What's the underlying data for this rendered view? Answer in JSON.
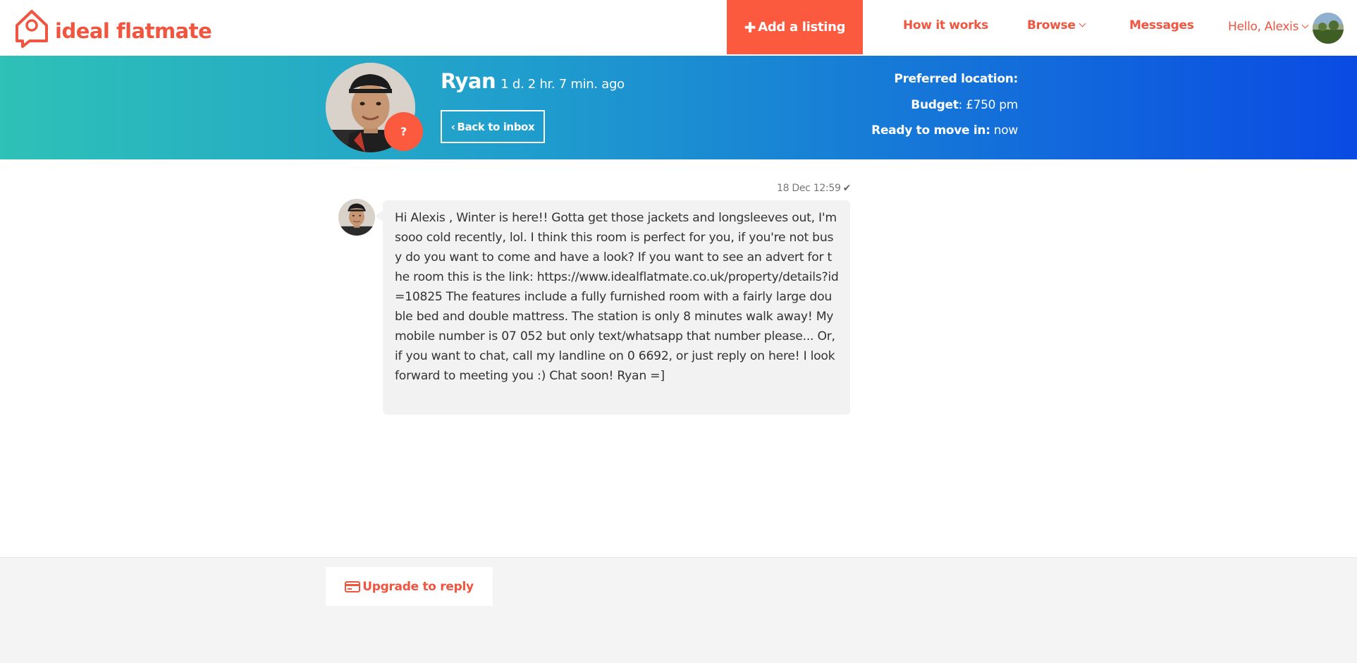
{
  "nav": {
    "logo_text": "ideal flatmate",
    "add_listing_label": "Add a listing",
    "how_it_works_label": "How it works",
    "browse_label": "Browse",
    "messages_label": "Messages",
    "hello_label": "Hello, Alexis"
  },
  "conversation": {
    "contact_name": "Ryan",
    "last_seen": "1 d. 2 hr. 7 min. ago",
    "back_label": "Back to inbox",
    "verification_badge": "?",
    "preferred_location_label": "Preferred location:",
    "budget_label": "Budget",
    "budget_value": ": £750 pm",
    "move_in_label": "Ready to move in:",
    "move_in_value": " now"
  },
  "messages": [
    {
      "timestamp": "18 Dec 12:59",
      "status_icon": "check-icon",
      "text": "Hi Alexis , Winter is here!! Gotta get those jackets and longsleeves out, I'm sooo cold recently, lol. I think this room is perfect for you, if you're not busy do you want to come and have a look? If you want to see an advert for the room this is the link: https://www.idealflatmate.co.uk/property/details?id=10825 The features include a fully furnished room with a fairly large double bed and double mattress. The station is only 8 minutes walk away! My mobile number is 07 052 but only text/whatsapp that number please... Or, if you want to chat, call my landline on 0 6692, or just reply on here! I look forward to meeting you :) Chat soon! Ryan =]"
    }
  ],
  "footer": {
    "upgrade_label": "Upgrade to reply"
  },
  "colors": {
    "brand": "#fb5a3f",
    "banner_start": "#2ec1b7",
    "banner_end": "#0a4be3",
    "bubble": "#f2f2f2"
  }
}
